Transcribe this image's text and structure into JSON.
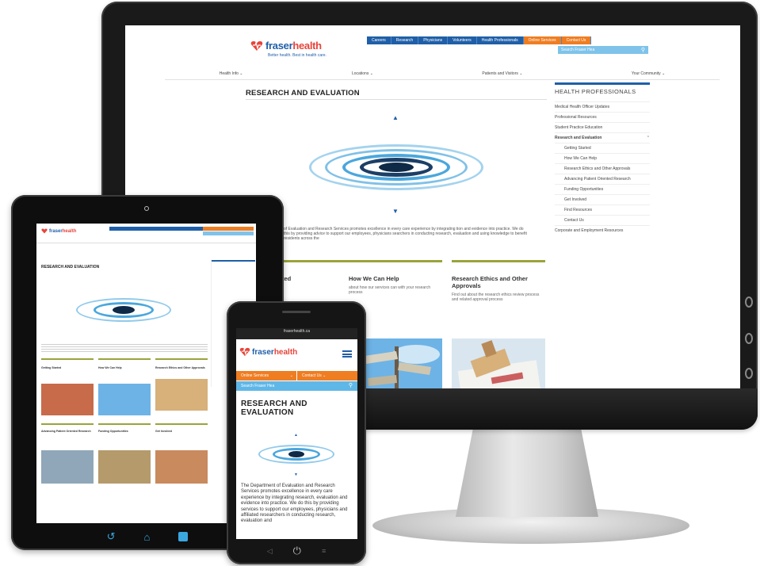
{
  "site": {
    "brand_a": "fraser",
    "brand_b": "health",
    "tagline": "Better health. Best in health care.",
    "top_nav": [
      "Careers",
      "Research",
      "Physicians",
      "Volunteers",
      "Health Professionals",
      "Online Services",
      "Contact Us"
    ],
    "search_placeholder": "Search Fraser Hea",
    "main_menu": [
      "Health Info",
      "Locations",
      "Patients and Visitors",
      "Your Community"
    ],
    "page_title": "RESEARCH AND EVALUATION",
    "phone_title": "RESEARCH AND EVALUATION",
    "sidebar": {
      "heading": "HEALTH PROFESSIONALS",
      "items": [
        {
          "label": "Medical Health Officer Updates",
          "sub": false
        },
        {
          "label": "Professional Resources",
          "sub": false
        },
        {
          "label": "Student Practice Education",
          "sub": false
        },
        {
          "label": "Research and Evaluation",
          "sub": false,
          "active": true
        },
        {
          "label": "Getting Started",
          "sub": true
        },
        {
          "label": "How We Can Help",
          "sub": true
        },
        {
          "label": "Research Ethics and Other Approvals",
          "sub": true
        },
        {
          "label": "Advancing Patient Oriented Research",
          "sub": true
        },
        {
          "label": "Funding Opportunities",
          "sub": true
        },
        {
          "label": "Get Involved",
          "sub": true
        },
        {
          "label": "Find Resources",
          "sub": true
        },
        {
          "label": "Contact Us",
          "sub": true
        },
        {
          "label": "Corporate and Employment Resources",
          "sub": false
        }
      ]
    },
    "intro_text": "of Evaluation and Research Services promotes excellence in every care experience by integrating tion and evidence into practice. We do this by providing advice to support our employees, physicians searchers in conducting research, evaluation and using knowledge to benefit residents across the",
    "columns": [
      {
        "title": "ted",
        "text": ""
      },
      {
        "title": "How We Can Help",
        "text": "about how our services can with your research process"
      },
      {
        "title": "Research Ethics and Other Approvals",
        "text": "Find out about the research ethics review process and related approval process"
      }
    ],
    "tablet_tiles": [
      "Getting Started",
      "How We Can Help",
      "Research Ethics and Other Approvals",
      "Advancing Patient Oriented Research",
      "Funding Opportunities",
      "Get Involved"
    ],
    "phone_online": "Online Services",
    "phone_contact": "Contact Us",
    "phone_search": "Search Fraser Hea",
    "phone_status_url": "fraserhealth.ca",
    "phone_body": "The Department of Evaluation and Research Services promotes excellence in every care experience by integrating research, evaluation and evidence into practice. We do this by providing services to support our employees, physicians and affiliated researchers in conducting research, evaluation and"
  },
  "colors": {
    "brand_blue": "#1f5fa8",
    "brand_orange": "#ef7d22",
    "accent_green": "#9aa43a",
    "ripple_blue": "#4aa7dd"
  }
}
